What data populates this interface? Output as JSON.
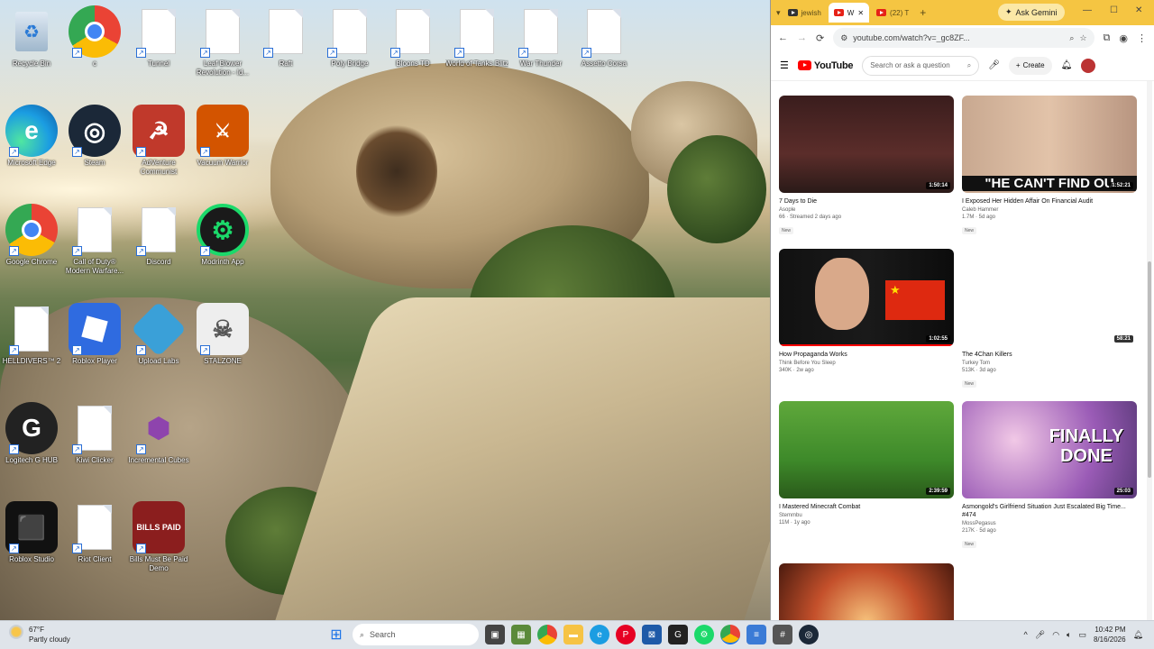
{
  "desktop": {
    "icons": [
      {
        "label": "Recycle Bin",
        "icon": "recycle-bin-icon"
      },
      {
        "label": "c",
        "icon": "chrome-profile-icon"
      },
      {
        "label": "Tunnel",
        "icon": "file-icon"
      },
      {
        "label": "Leaf Blower Revolution - Id...",
        "icon": "file-icon"
      },
      {
        "label": "Raft",
        "icon": "file-icon"
      },
      {
        "label": "Poly Bridge",
        "icon": "file-icon"
      },
      {
        "label": "Bloons TD",
        "icon": "file-icon"
      },
      {
        "label": "World of Tanks Blitz",
        "icon": "file-icon"
      },
      {
        "label": "War Thunder",
        "icon": "file-icon"
      },
      {
        "label": "Assetto Corsa",
        "icon": "file-icon"
      },
      {
        "label": "Microsoft Edge",
        "icon": "edge-icon"
      },
      {
        "label": "Steam",
        "icon": "steam-icon"
      },
      {
        "label": "AdVenture Communist",
        "icon": "adventure-communist-icon"
      },
      {
        "label": "Vacuum Warrior",
        "icon": "vacuum-warrior-icon"
      },
      {
        "label": "Google Chrome",
        "icon": "chrome-icon"
      },
      {
        "label": "Call of Duty® Modern Warfare...",
        "icon": "file-icon"
      },
      {
        "label": "Discord",
        "icon": "file-icon"
      },
      {
        "label": "Modrinth App",
        "icon": "modrinth-icon"
      },
      {
        "label": "HELLDIVERS™ 2",
        "icon": "file-icon"
      },
      {
        "label": "Roblox Player",
        "icon": "roblox-icon"
      },
      {
        "label": "Upload Labs",
        "icon": "upload-labs-icon"
      },
      {
        "label": "STALZONE",
        "icon": "stalzone-icon"
      },
      {
        "label": "Logitech G HUB",
        "icon": "logitech-icon"
      },
      {
        "label": "Kiwi Clicker",
        "icon": "file-icon"
      },
      {
        "label": "Incremental Cubes",
        "icon": "incremental-cubes-icon"
      },
      {
        "label": "Roblox Studio",
        "icon": "roblox-studio-icon"
      },
      {
        "label": "Riot Client",
        "icon": "file-icon"
      },
      {
        "label": "Bills Must Be Paid Demo",
        "icon": "bills-icon"
      }
    ]
  },
  "browser": {
    "tabs": [
      {
        "label": "jewish",
        "active": false
      },
      {
        "label": "W",
        "active": true
      },
      {
        "label": "(22) T",
        "active": false
      }
    ],
    "new_tab": "+",
    "gemini": "Ask Gemini",
    "url": "youtube.com/watch?v=_gc8ZF...",
    "youtube": {
      "logo": "YouTube",
      "search_placeholder": "Search or ask a question",
      "create": "Create"
    },
    "videos": [
      {
        "title": "7 Days to Die",
        "channel": "Asople",
        "meta": "66 · Streamed 2 days ago",
        "badge": "New",
        "duration": "1:50:14",
        "thumb": "dark-game"
      },
      {
        "title": "I Exposed Her Hidden Affair On Financial Audit",
        "channel": "Caleb Hammer",
        "meta": "1.7M · 5d ago",
        "badge": "New",
        "duration": "1:52:21",
        "thumb_text": "\"HE CAN'T FIND OU",
        "thumb": "faces"
      },
      {
        "title": "How Propaganda Works",
        "channel": "Think Before You Sleep",
        "meta": "340K · 2w ago",
        "badge": "",
        "duration": "1:02:55",
        "thumb": "flag"
      },
      {
        "title": "The 4Chan Killers",
        "channel": "Turkey Tom",
        "meta": "513K · 3d ago",
        "badge": "New",
        "duration": "58:21",
        "thumb": "blank"
      },
      {
        "title": "I Mastered Minecraft Combat",
        "channel": "Stemmbu",
        "meta": "11M · 1y ago",
        "badge": "",
        "duration": "2:39:59",
        "thumb": "minecraft"
      },
      {
        "title": "Asmongold's Girlfriend Situation Just Escalated Big Time... #474",
        "channel": "MossPegasus",
        "meta": "217K · 5d ago",
        "badge": "New",
        "duration": "25:03",
        "thumb_text": "FINALLY DONE",
        "thumb": "anime"
      },
      {
        "title": "",
        "channel": "",
        "meta": "",
        "badge": "",
        "duration": "",
        "thumb": "fire"
      }
    ]
  },
  "taskbar": {
    "weather_temp": "67°F",
    "weather_desc": "Partly cloudy",
    "search": "Search",
    "time": "10:42 PM",
    "date": "8/16/2026"
  }
}
